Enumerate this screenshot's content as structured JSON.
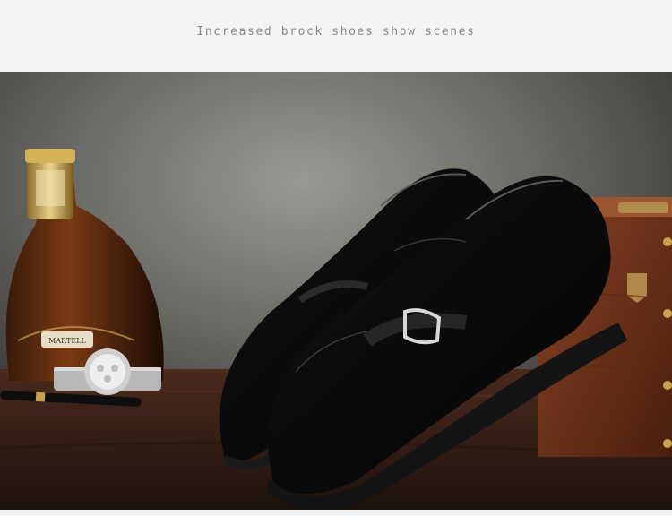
{
  "header": {
    "caption": "Increased brock shoes show scenes"
  },
  "photo": {
    "subject": "black-leather-monk-strap-loafers-icon",
    "props": [
      "cognac-bottle-icon",
      "wristwatch-icon",
      "pen-icon",
      "wooden-chest-icon"
    ],
    "bottle_label": "MARTELL",
    "colors": {
      "backdrop": "#8a8a84",
      "table": "#3a2118",
      "leather": "#0e0e0e",
      "wood_chest": "#7a3a1e",
      "brass": "#c9a24a"
    }
  }
}
